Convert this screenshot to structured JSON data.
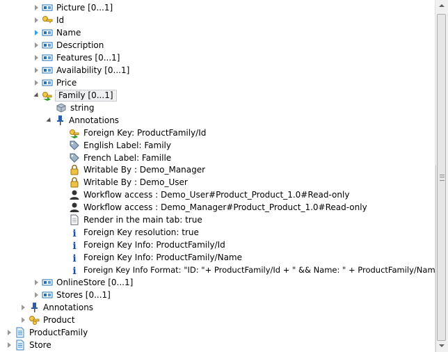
{
  "tree": {
    "rows": [
      {
        "label": "Picture  [0...1]",
        "icon": "element-icon",
        "toggle": "closed"
      },
      {
        "label": "Id",
        "icon": "key-icon",
        "toggle": "closed"
      },
      {
        "label": "Name",
        "icon": "element-icon",
        "toggle": "closed-blue"
      },
      {
        "label": "Description",
        "icon": "element-icon",
        "toggle": "closed"
      },
      {
        "label": "Features  [0...1]",
        "icon": "element-icon",
        "toggle": "closed"
      },
      {
        "label": "Availability  [0...1]",
        "icon": "element-icon",
        "toggle": "closed"
      },
      {
        "label": "Price",
        "icon": "element-icon",
        "toggle": "closed"
      },
      {
        "label": "Family  [0...1]",
        "icon": "foreign-key-icon",
        "toggle": "open",
        "selected": true
      },
      {
        "label": "string",
        "icon": "type-icon",
        "toggle": "none"
      },
      {
        "label": "Annotations",
        "icon": "pin-icon",
        "toggle": "open"
      },
      {
        "label": "Foreign Key:  ProductFamily/Id",
        "icon": "foreign-key-icon",
        "toggle": "none"
      },
      {
        "label": "English Label: Family",
        "icon": "tag-icon",
        "toggle": "none"
      },
      {
        "label": "French Label: Famille",
        "icon": "tag-icon",
        "toggle": "none"
      },
      {
        "label": "Writable By : Demo_Manager",
        "icon": "lock-icon",
        "toggle": "none"
      },
      {
        "label": "Writable By : Demo_User",
        "icon": "lock-icon",
        "toggle": "none"
      },
      {
        "label": "Workflow access : Demo_User#Product_Product_1.0#Read-only",
        "icon": "user-icon",
        "toggle": "none"
      },
      {
        "label": "Workflow access : Demo_Manager#Product_Product_1.0#Read-only",
        "icon": "user-icon",
        "toggle": "none"
      },
      {
        "label": "Render in the main tab: true",
        "icon": "document-icon",
        "toggle": "none"
      },
      {
        "label": "Foreign Key resolution:  true",
        "icon": "info-icon",
        "toggle": "none"
      },
      {
        "label": "Foreign Key Info:  ProductFamily/Id",
        "icon": "info-icon",
        "toggle": "none"
      },
      {
        "label": "Foreign Key Info:  ProductFamily/Name",
        "icon": "info-icon",
        "toggle": "none"
      },
      {
        "label": "Foreign Key Info Format: \"ID: \"+ ProductFamily/Id  + \" && Name: \" + ProductFamily/Name",
        "icon": "info-icon",
        "toggle": "none"
      },
      {
        "label": "OnlineStore  [0...1]",
        "icon": "element-icon",
        "toggle": "closed"
      },
      {
        "label": "Stores  [0...1]",
        "icon": "element-icon",
        "toggle": "closed"
      },
      {
        "label": "Annotations",
        "icon": "pin-icon",
        "toggle": "closed"
      },
      {
        "label": "Product",
        "icon": "key-group-icon",
        "toggle": "closed"
      },
      {
        "label": "ProductFamily",
        "icon": "page-icon",
        "toggle": "closed"
      },
      {
        "label": "Store",
        "icon": "page-icon",
        "toggle": "closed"
      }
    ]
  },
  "colors": {
    "element_blue": "#1d6fb8",
    "key_gold": "#d9a21b",
    "fk_green": "#3a9a2b",
    "info_blue": "#1f4fa0",
    "pin_blue": "#2a5db0"
  }
}
